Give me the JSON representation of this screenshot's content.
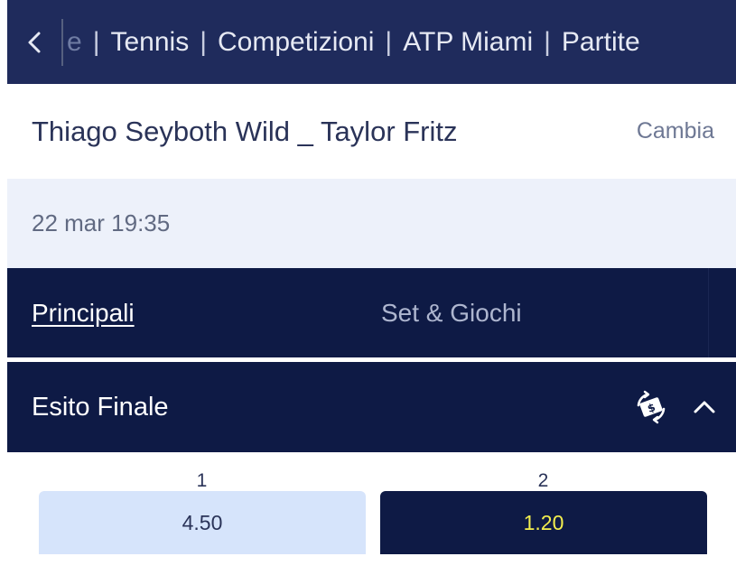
{
  "breadcrumb": {
    "back_icon": "chevron-left-icon",
    "items": [
      "e",
      "Tennis",
      "Competizioni",
      "ATP Miami",
      "Partite"
    ],
    "separator": "|"
  },
  "match": {
    "title": "Thiago Seyboth Wild _ Taylor Fritz",
    "change_label": "Cambia"
  },
  "event": {
    "datetime": "22 mar 19:35"
  },
  "tabs": [
    {
      "label": "Principali",
      "active": true
    },
    {
      "label": "Set & Giochi",
      "active": false
    }
  ],
  "market": {
    "title": "Esito Finale",
    "cashout_icon": "cash-swap-icon",
    "collapse_icon": "chevron-up-icon"
  },
  "outcomes": [
    {
      "label": "1",
      "odds": "4.50"
    },
    {
      "label": "2",
      "odds": "1.20"
    }
  ],
  "colors": {
    "header_bg": "#1f2b5c",
    "dark_bg": "#0e1a45",
    "light_odds_bg": "#d6e4fb",
    "highlight_odds_text": "#f3ee4e",
    "date_row_bg": "#edf1fa"
  }
}
